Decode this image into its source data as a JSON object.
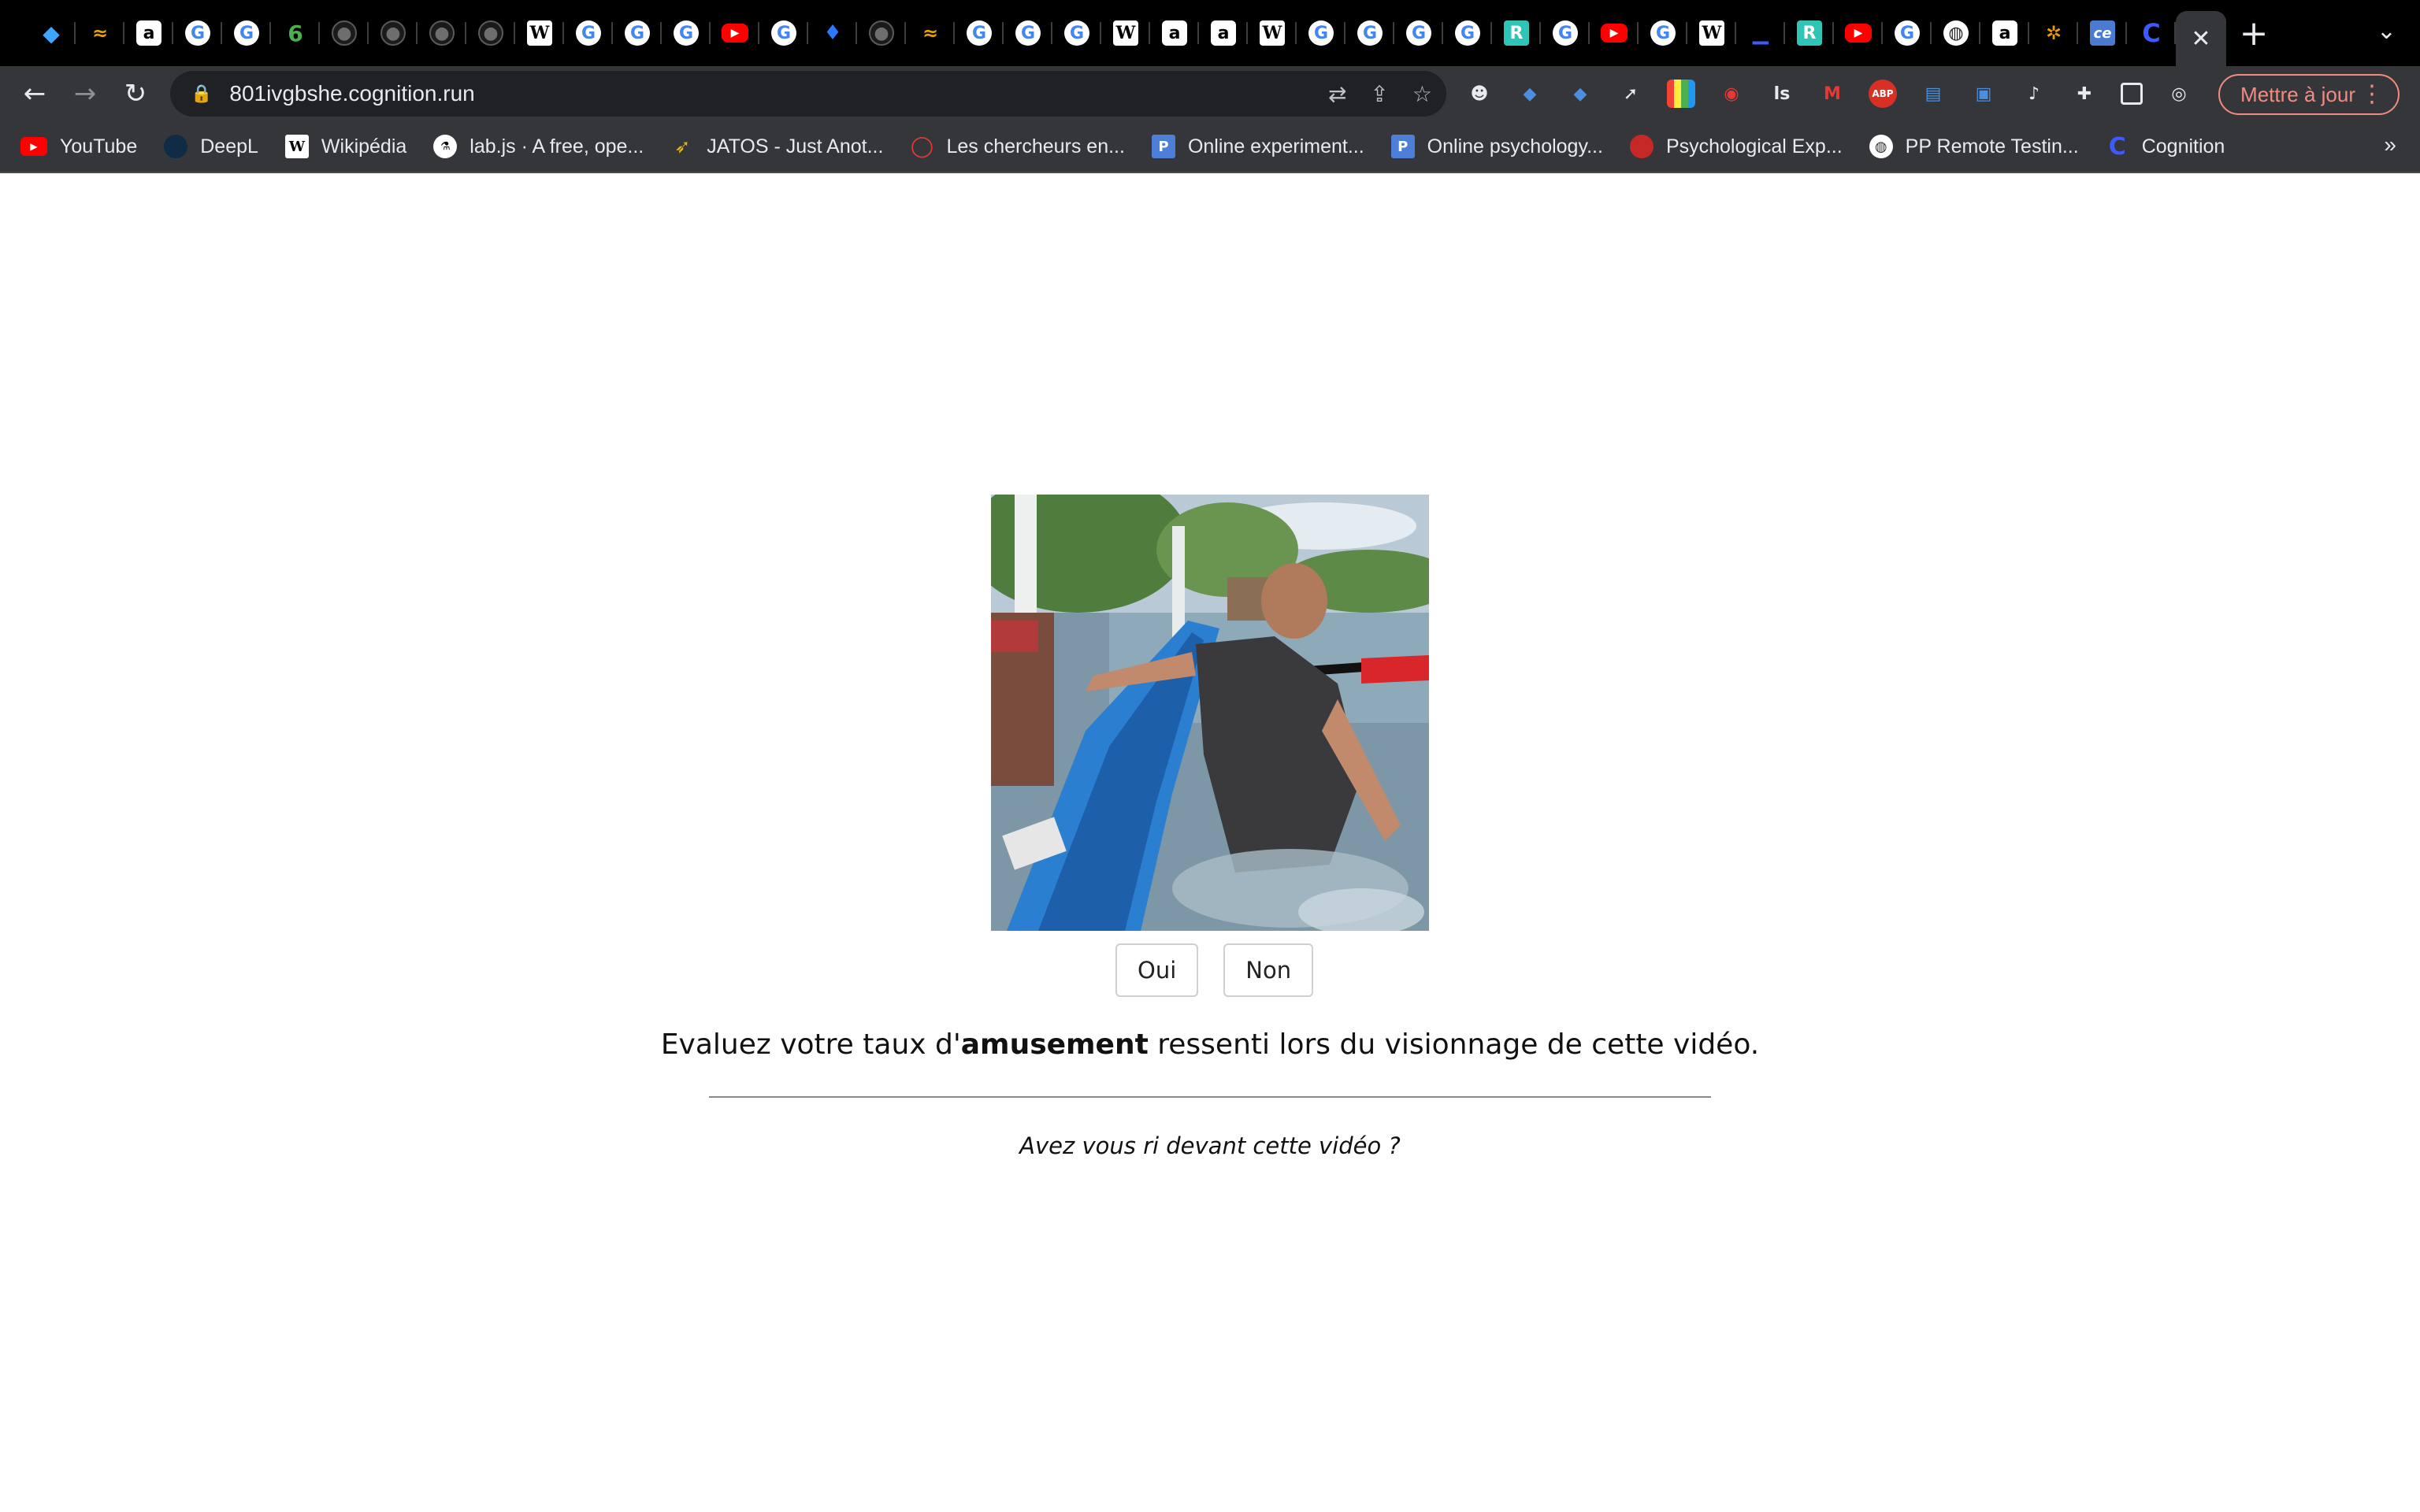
{
  "browser": {
    "tabs": [
      {
        "icon": "gem-icon",
        "glyph": "◆",
        "kind": "gem"
      },
      {
        "icon": "rainbow-icon",
        "glyph": "≈",
        "kind": "rainbow"
      },
      {
        "icon": "amazon-icon",
        "glyph": "a",
        "kind": "amazon"
      },
      {
        "icon": "google-icon",
        "glyph": "G",
        "kind": "google"
      },
      {
        "icon": "google-icon",
        "glyph": "G",
        "kind": "google"
      },
      {
        "icon": "leaf-icon",
        "glyph": "6",
        "kind": "green"
      },
      {
        "icon": "github-icon",
        "glyph": "●",
        "kind": "github"
      },
      {
        "icon": "github-icon",
        "glyph": "●",
        "kind": "github"
      },
      {
        "icon": "github-icon",
        "glyph": "●",
        "kind": "github"
      },
      {
        "icon": "github-icon",
        "glyph": "●",
        "kind": "github"
      },
      {
        "icon": "wikipedia-icon",
        "glyph": "W",
        "kind": "wiki"
      },
      {
        "icon": "google-icon",
        "glyph": "G",
        "kind": "google"
      },
      {
        "icon": "google-icon",
        "glyph": "G",
        "kind": "google"
      },
      {
        "icon": "google-icon",
        "glyph": "G",
        "kind": "google"
      },
      {
        "icon": "youtube-icon",
        "glyph": "▶",
        "kind": "youtube"
      },
      {
        "icon": "google-icon",
        "glyph": "G",
        "kind": "google"
      },
      {
        "icon": "pin-icon",
        "glyph": "♦",
        "kind": "pin"
      },
      {
        "icon": "github-icon",
        "glyph": "●",
        "kind": "github"
      },
      {
        "icon": "rainbow-icon",
        "glyph": "≈",
        "kind": "rainbow"
      },
      {
        "icon": "google-icon",
        "glyph": "G",
        "kind": "google"
      },
      {
        "icon": "google-icon",
        "glyph": "G",
        "kind": "google"
      },
      {
        "icon": "google-icon",
        "glyph": "G",
        "kind": "google"
      },
      {
        "icon": "wikipedia-icon",
        "glyph": "W",
        "kind": "wiki"
      },
      {
        "icon": "amazon-icon",
        "glyph": "a",
        "kind": "amazon"
      },
      {
        "icon": "amazon-icon",
        "glyph": "a",
        "kind": "amazon"
      },
      {
        "icon": "wikipedia-icon",
        "glyph": "W",
        "kind": "wiki"
      },
      {
        "icon": "google-icon",
        "glyph": "G",
        "kind": "google"
      },
      {
        "icon": "google-icon",
        "glyph": "G",
        "kind": "google"
      },
      {
        "icon": "google-icon",
        "glyph": "G",
        "kind": "google"
      },
      {
        "icon": "google-icon",
        "glyph": "G",
        "kind": "google"
      },
      {
        "icon": "r-icon",
        "glyph": "R",
        "kind": "r"
      },
      {
        "icon": "google-icon",
        "glyph": "G",
        "kind": "google"
      },
      {
        "icon": "youtube-icon",
        "glyph": "▶",
        "kind": "youtube"
      },
      {
        "icon": "google-icon",
        "glyph": "G",
        "kind": "google"
      },
      {
        "icon": "wikipedia-icon",
        "glyph": "W",
        "kind": "wiki"
      },
      {
        "icon": "bar-icon",
        "glyph": "▁",
        "kind": "bar"
      },
      {
        "icon": "r-icon",
        "glyph": "R",
        "kind": "r"
      },
      {
        "icon": "youtube-icon",
        "glyph": "▶",
        "kind": "youtube"
      },
      {
        "icon": "google-icon",
        "glyph": "G",
        "kind": "google"
      },
      {
        "icon": "globe-icon",
        "glyph": "◍",
        "kind": "globe"
      },
      {
        "icon": "amazon-icon",
        "glyph": "a",
        "kind": "amazon"
      },
      {
        "icon": "multicolor-icon",
        "glyph": "✲",
        "kind": "rainbow"
      },
      {
        "icon": "ce-icon",
        "glyph": "ce",
        "kind": "ce"
      },
      {
        "icon": "cognition-icon",
        "glyph": "C",
        "kind": "c"
      }
    ],
    "active_tab_close": "✕",
    "new_tab": "+",
    "tab_search": "⌄",
    "nav": {
      "back": "←",
      "forward": "→",
      "reload": "↻"
    },
    "lock": "🔒",
    "url": "801ivgbshe.cognition.run",
    "omnibox_icons": [
      {
        "name": "translate-icon",
        "glyph": "⇄"
      },
      {
        "name": "share-icon",
        "glyph": "⇪"
      },
      {
        "name": "bookmark-star-icon",
        "glyph": "☆"
      }
    ],
    "extensions": [
      {
        "name": "extension-cookie-icon",
        "glyph": "☻",
        "kind": ""
      },
      {
        "name": "extension-graduation-icon",
        "glyph": "◆",
        "kind": "blue"
      },
      {
        "name": "extension-gem-icon",
        "glyph": "◆",
        "kind": "blue"
      },
      {
        "name": "extension-rocket-icon",
        "glyph": "➚",
        "kind": ""
      },
      {
        "name": "extension-colorgrid-icon",
        "glyph": "",
        "kind": "grid"
      },
      {
        "name": "extension-eye-icon",
        "glyph": "◉",
        "kind": "red"
      },
      {
        "name": "extension-ls-icon",
        "glyph": "ls",
        "kind": ""
      },
      {
        "name": "extension-m-icon",
        "glyph": "M",
        "kind": "red"
      },
      {
        "name": "extension-abp-icon",
        "glyph": "ABP",
        "kind": "abp"
      },
      {
        "name": "extension-doc-icon",
        "glyph": "▤",
        "kind": "blue"
      },
      {
        "name": "extension-book-icon",
        "glyph": "▣",
        "kind": "blue"
      },
      {
        "name": "extension-bell-icon",
        "glyph": "♪",
        "kind": ""
      },
      {
        "name": "extensions-puzzle-icon",
        "glyph": "✚",
        "kind": ""
      },
      {
        "name": "side-panel-icon",
        "glyph": "",
        "kind": "square"
      },
      {
        "name": "profile-brain-icon",
        "glyph": "◎",
        "kind": ""
      }
    ],
    "update_button": "Mettre à jour",
    "menu_kebab": "⋮",
    "bookmarks": [
      {
        "label": "YouTube",
        "icon": "youtube-icon",
        "glyph": "▶",
        "kind": "yt"
      },
      {
        "label": "DeepL",
        "icon": "deepl-icon",
        "glyph": "●",
        "kind": "deepl"
      },
      {
        "label": "Wikipédia",
        "icon": "wikipedia-icon",
        "glyph": "W",
        "kind": "wiki"
      },
      {
        "label": "lab.js · A free, ope...",
        "icon": "labjs-icon",
        "glyph": "⚗",
        "kind": "lab"
      },
      {
        "label": "JATOS - Just Anot...",
        "icon": "jatos-icon",
        "glyph": "➶",
        "kind": "jatos"
      },
      {
        "label": "Les chercheurs en...",
        "icon": "chat-bubble-icon",
        "glyph": "◯",
        "kind": "chat"
      },
      {
        "label": "Online experiment...",
        "icon": "pavlovia-icon",
        "glyph": "P",
        "kind": "p"
      },
      {
        "label": "Online psychology...",
        "icon": "pavlovia-icon",
        "glyph": "P",
        "kind": "p"
      },
      {
        "label": "Psychological Exp...",
        "icon": "psychology-icon",
        "glyph": "●",
        "kind": "psy"
      },
      {
        "label": "PP Remote Testin...",
        "icon": "globe-icon",
        "glyph": "◍",
        "kind": "globe"
      },
      {
        "label": "Cognition",
        "icon": "cognition-icon",
        "glyph": "C",
        "kind": "cog"
      }
    ],
    "bookmarks_overflow": "»"
  },
  "page": {
    "choices": [
      "Oui",
      "Non"
    ],
    "question_prefix": "Evaluez votre taux d'",
    "question_emphasis": "amusement",
    "question_suffix": " ressenti lors du visionnage de cette vidéo.",
    "sub_question": "Avez vous ri devant cette vidéo ?"
  }
}
